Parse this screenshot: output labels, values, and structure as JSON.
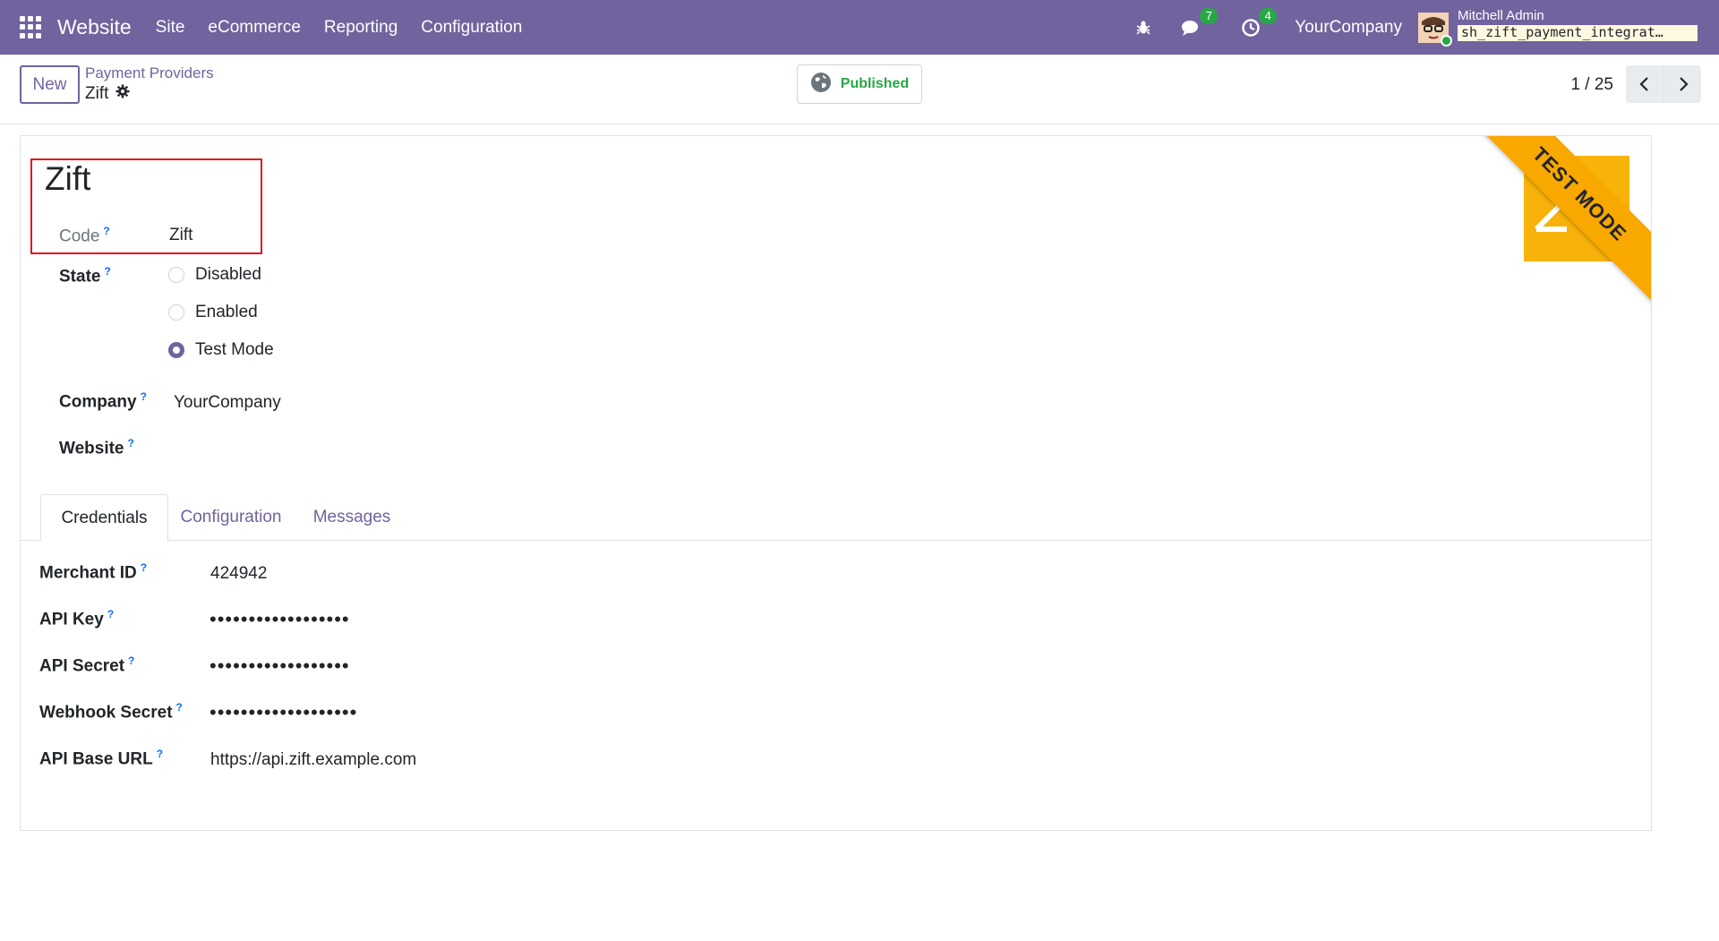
{
  "navbar": {
    "app_name": "Website",
    "menu": [
      "Site",
      "eCommerce",
      "Reporting",
      "Configuration"
    ],
    "messages_count": "7",
    "activities_count": "4",
    "company": "YourCompany",
    "user_name": "Mitchell Admin",
    "database": "sh_zift_payment_integrat…"
  },
  "control_panel": {
    "new_label": "New",
    "breadcrumb": "Payment Providers",
    "record_name": "Zift",
    "published_label": "Published",
    "pager": "1 / 25"
  },
  "form": {
    "title": "Zift",
    "code_label": "Code",
    "code_value": "Zift",
    "state_label": "State",
    "state_options": [
      "Disabled",
      "Enabled",
      "Test Mode"
    ],
    "state_selected": "Test Mode",
    "company_label": "Company",
    "company_value": "YourCompany",
    "website_label": "Website",
    "website_value": "",
    "ribbon": "TEST MODE",
    "help_marker": "?"
  },
  "tabs": [
    "Credentials",
    "Configuration",
    "Messages"
  ],
  "credentials": {
    "merchant_id_label": "Merchant ID",
    "merchant_id_value": "424942",
    "api_key_label": "API Key",
    "api_key_value": "••••••••••••••••••",
    "api_secret_label": "API Secret",
    "api_secret_value": "••••••••••••••••••",
    "webhook_secret_label": "Webhook Secret",
    "webhook_secret_value": "•••••••••••••••••••",
    "api_base_url_label": "API Base URL",
    "api_base_url_value": "https://api.zift.example.com"
  },
  "colors": {
    "brand": "#71639e",
    "published": "#28a745",
    "highlight": "#e3141b",
    "ribbon": "#f9a800"
  },
  "icons": [
    "apps-grid-icon",
    "bug-icon",
    "chat-icon",
    "clock-icon",
    "gear-icon",
    "globe-icon",
    "chevron-left-icon",
    "chevron-right-icon"
  ]
}
